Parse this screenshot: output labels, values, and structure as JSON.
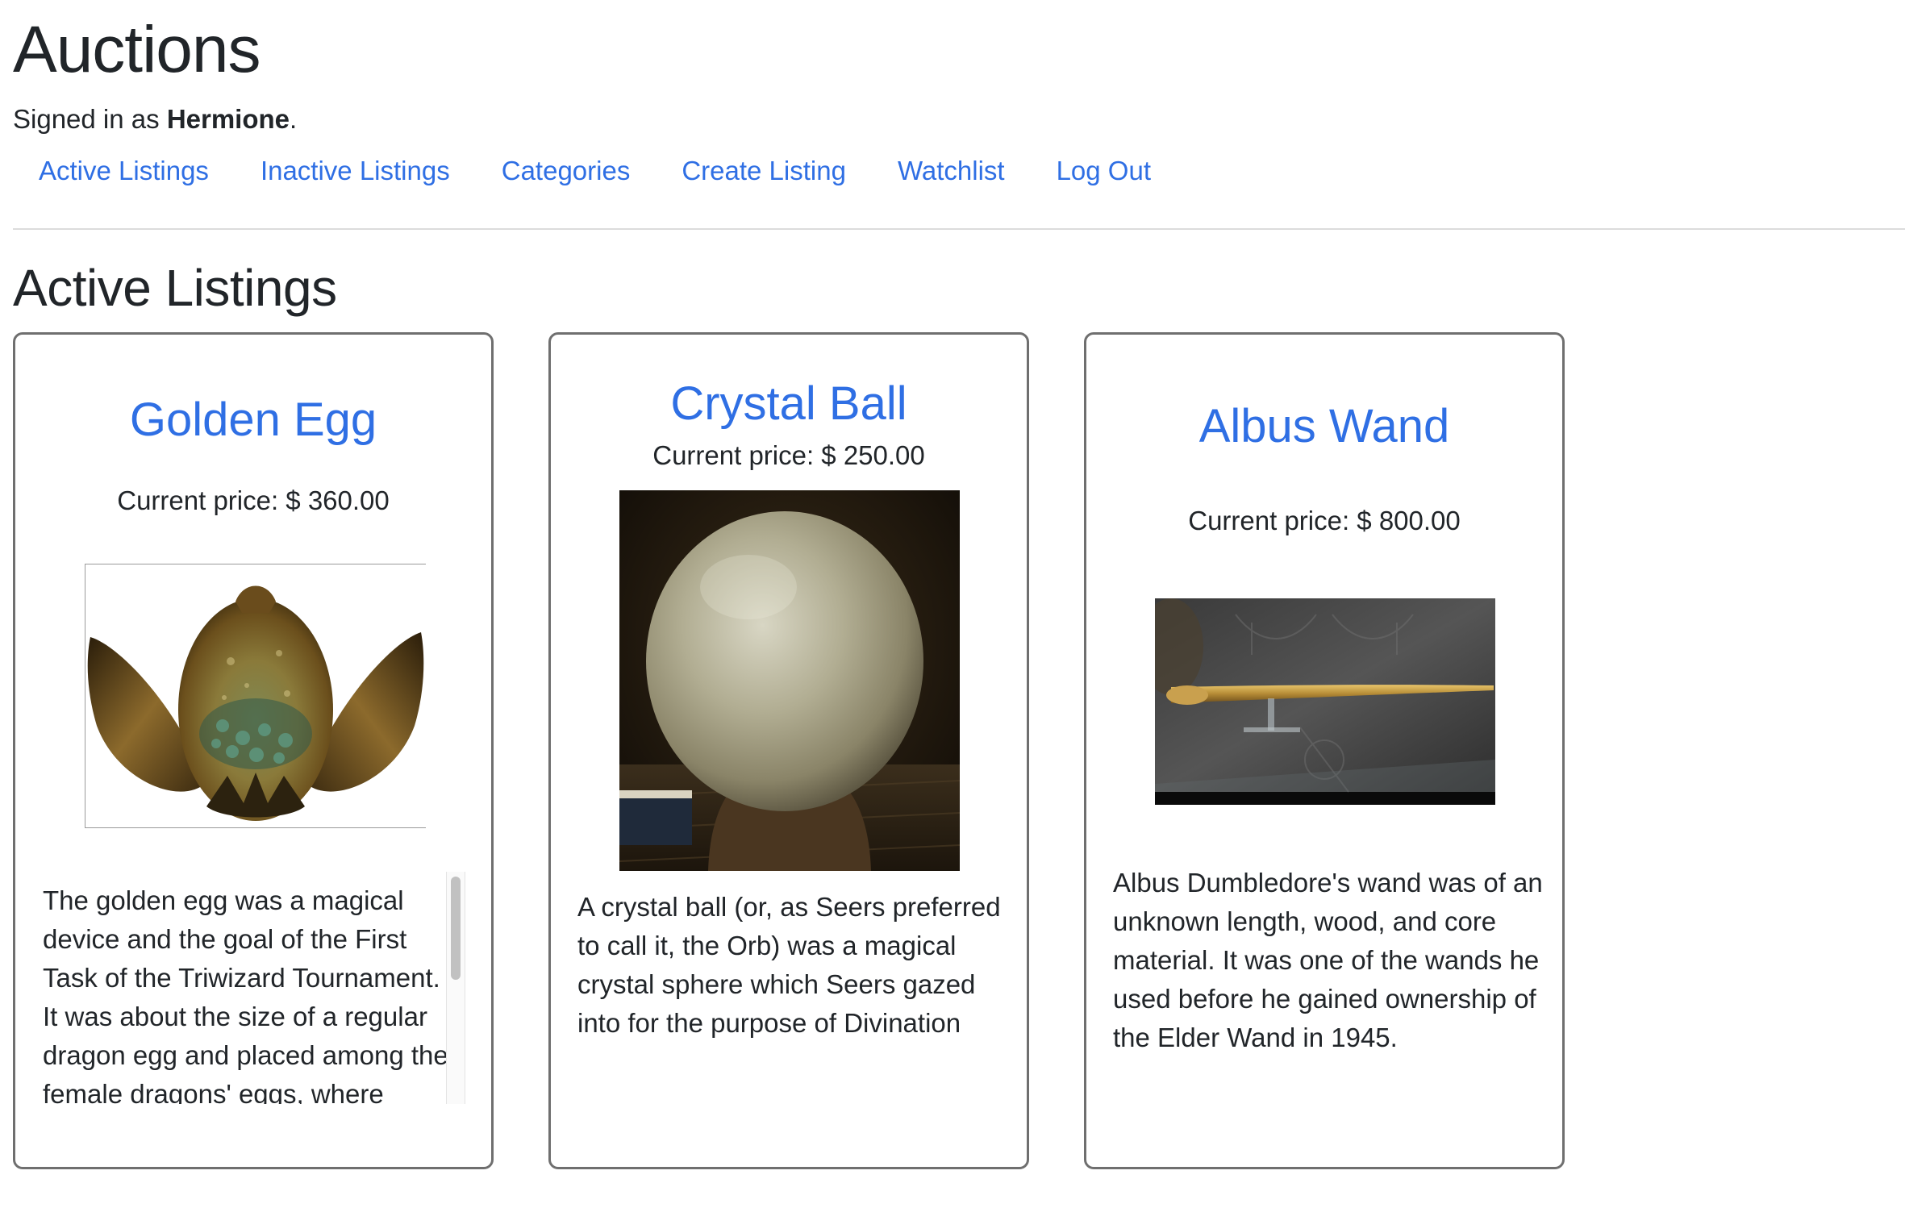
{
  "header": {
    "title": "Auctions",
    "signed_in_prefix": "Signed in as ",
    "username": "Hermione",
    "signed_in_suffix": "."
  },
  "nav": {
    "items": [
      {
        "label": "Active Listings"
      },
      {
        "label": "Inactive Listings"
      },
      {
        "label": "Categories"
      },
      {
        "label": "Create Listing"
      },
      {
        "label": "Watchlist"
      },
      {
        "label": "Log Out"
      }
    ]
  },
  "main": {
    "heading": "Active Listings",
    "listings": [
      {
        "title": "Golden Egg",
        "price": "Current price: $ 360.00",
        "image": "golden-egg-image",
        "description": "The golden egg was a magical device and the goal of the First Task of the Triwizard Tournament. It was about the size of a regular dragon egg and placed among the female dragons' eggs, where"
      },
      {
        "title": "Crystal Ball",
        "price": "Current price: $ 250.00",
        "image": "crystal-ball-image",
        "description": "A crystal ball (or, as Seers preferred to call it, the Orb) was a magical crystal sphere which Seers gazed into for the purpose of Divination"
      },
      {
        "title": "Albus Wand",
        "price": "Current price: $ 800.00",
        "image": "wand-image",
        "description": "Albus Dumbledore's wand was of an unknown length, wood, and core material. It was one of the wands he used before he gained ownership of the Elder Wand in 1945."
      }
    ]
  },
  "colors": {
    "link": "#2f6fe4",
    "text": "#212529",
    "card_border": "#6f6f6f",
    "divider": "#dcdcdc"
  }
}
